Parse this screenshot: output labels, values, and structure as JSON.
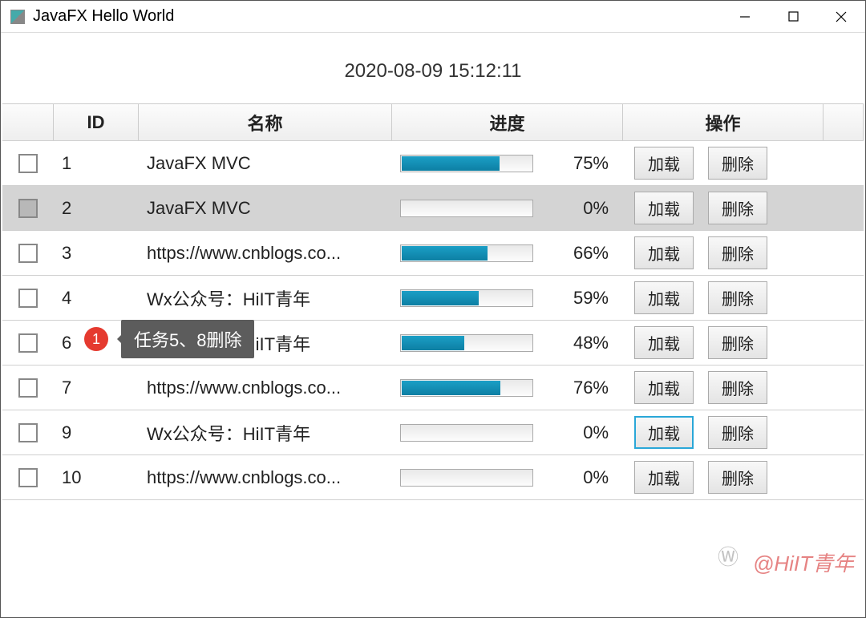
{
  "window": {
    "title": "JavaFX Hello World"
  },
  "timestamp": "2020-08-09 15:12:11",
  "columns": {
    "id": "ID",
    "name": "名称",
    "progress": "进度",
    "ops": "操作"
  },
  "buttons": {
    "load": "加载",
    "delete": "删除"
  },
  "rows": [
    {
      "id": "1",
      "name": "JavaFX MVC",
      "progress": 75,
      "selected": false,
      "loadFocused": false
    },
    {
      "id": "2",
      "name": "JavaFX MVC",
      "progress": 0,
      "selected": true,
      "loadFocused": false
    },
    {
      "id": "3",
      "name": "https://www.cnblogs.co...",
      "progress": 66,
      "selected": false,
      "loadFocused": false
    },
    {
      "id": "4",
      "name": "Wx公众号：HiIT青年",
      "progress": 59,
      "selected": false,
      "loadFocused": false
    },
    {
      "id": "6",
      "name": "Wx公众号：HiIT青年",
      "progress": 48,
      "selected": false,
      "loadFocused": false
    },
    {
      "id": "7",
      "name": "https://www.cnblogs.co...",
      "progress": 76,
      "selected": false,
      "loadFocused": false
    },
    {
      "id": "9",
      "name": "Wx公众号：HiIT青年",
      "progress": 0,
      "selected": false,
      "loadFocused": true
    },
    {
      "id": "10",
      "name": "https://www.cnblogs.co...",
      "progress": 0,
      "selected": false,
      "loadFocused": false
    }
  ],
  "tooltip": {
    "badge": "1",
    "text": "任务5、8删除"
  },
  "watermark": "@HiIT青年"
}
